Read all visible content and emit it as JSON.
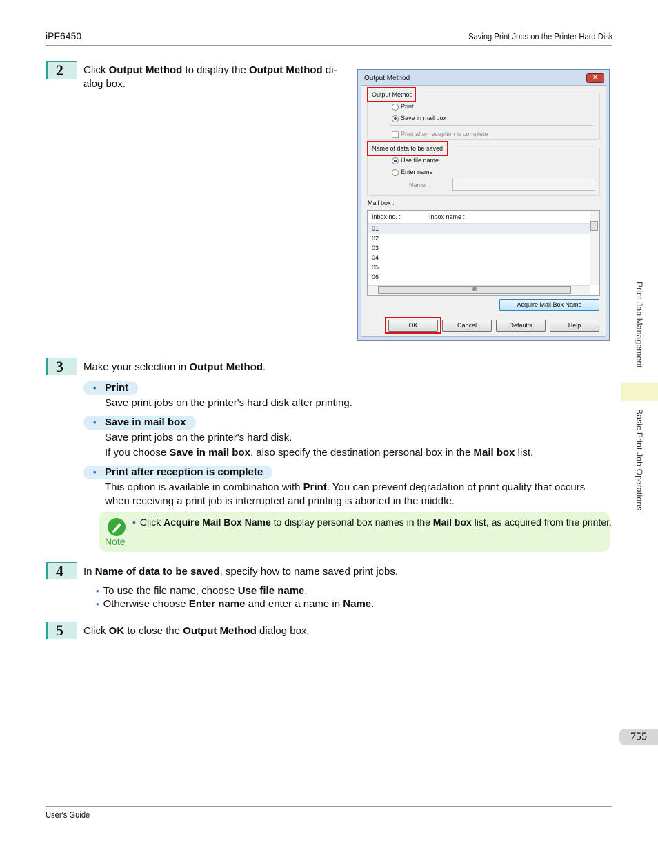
{
  "header": {
    "left": "iPF6450",
    "right": "Saving Print Jobs on the Printer Hard Disk"
  },
  "footer": {
    "left": "User's Guide"
  },
  "side": {
    "tab1": "Print Job Management",
    "tab2": "Basic Print Job Operations",
    "page": "755"
  },
  "step2": {
    "num": "2",
    "t1": "Click ",
    "b1": "Output Method",
    "t2": " to display the ",
    "b2": "Output Method",
    "t3": " di-",
    "line2": "alog box."
  },
  "dialog": {
    "title": "Output Method",
    "close": "✕",
    "group_output": "Output Method",
    "opt_print": "Print",
    "opt_save": "Save in mail box",
    "opt_after": "Print after reception is complete",
    "group_name": "Name of data to be saved",
    "opt_use_file": "Use file name",
    "opt_enter": "Enter name",
    "name_label": "Name :",
    "mailbox_label": "Mail box :",
    "col_inbox_no": "Inbox no. :",
    "col_inbox_name": "Inbox name :",
    "rows": [
      "01",
      "02",
      "03",
      "04",
      "05",
      "06"
    ],
    "scroll_mid": "III",
    "btn_acquire": "Acquire Mail Box Name",
    "btn_ok": "OK",
    "btn_cancel": "Cancel",
    "btn_defaults": "Defaults",
    "btn_help": "Help"
  },
  "step3": {
    "num": "3",
    "t1": "Make your selection in ",
    "b1": "Output Method",
    "t2": ".",
    "print_label": "Print",
    "print_desc": "Save print jobs on the printer's hard disk after printing.",
    "save_label": "Save in mail box",
    "save_desc1": "Save print jobs on the printer's hard disk.",
    "save_d2a": "If you choose ",
    "save_d2b": "Save in mail box",
    "save_d2c": ", also specify the destination personal box in the ",
    "save_d2d": "Mail box",
    "save_d2e": " list.",
    "after_label": "Print after reception is complete",
    "after_d1a": "This option is available in combination with ",
    "after_d1b": "Print",
    "after_d1c": ". You can prevent degradation of print quality that occurs",
    "after_d2": "when receiving a print job is interrupted and printing is aborted in the middle."
  },
  "note": {
    "label": "Note",
    "t1": "Click ",
    "b1": "Acquire Mail Box Name",
    "t2": " to display personal box names in the ",
    "b2": "Mail box",
    "t3": " list, as acquired from the printer."
  },
  "step4": {
    "num": "4",
    "t1": "In ",
    "b1": "Name of data to be saved",
    "t2": ", specify how to name saved print jobs.",
    "bul1a": "To use the file name, choose ",
    "bul1b": "Use file name",
    "bul1c": ".",
    "bul2a": "Otherwise choose ",
    "bul2b": "Enter name",
    "bul2c": " and enter a name in ",
    "bul2d": "Name",
    "bul2e": "."
  },
  "step5": {
    "num": "5",
    "t1": "Click ",
    "b1": "OK",
    "t2": " to close the ",
    "b2": "Output Method",
    "t3": " dialog box."
  }
}
